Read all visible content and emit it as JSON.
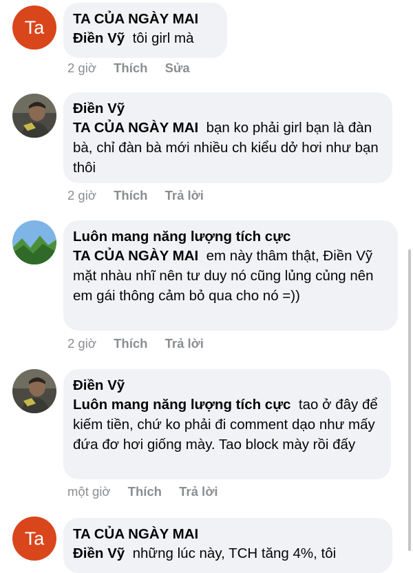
{
  "colors": {
    "bubble_bg": "#f0f2f5",
    "meta_text": "#8a8d91",
    "avatar_ta_bg": "#d9461c"
  },
  "comments": [
    {
      "avatar_text": "Ta",
      "author": "TA CỦA NGÀY MAI",
      "mention": "Điền Vỹ",
      "text": "tôi girl mà",
      "time": "2 giờ",
      "like": "Thích",
      "action": "Sửa"
    },
    {
      "author": "Điền Vỹ",
      "mention": "TA CỦA NGÀY MAI",
      "text": "bạn ko phải girl bạn là đàn bà, chỉ đàn bà mới nhiều ch  kiểu dở hơi như bạn thôi",
      "time": "2 giờ",
      "like": "Thích",
      "action": "Trả lời"
    },
    {
      "author": "Luôn mang năng lượng tích cực",
      "mention": "TA CỦA NGÀY MAI",
      "text": "em này thâm thật, Điền Vỹ mặt nhàu nhĩ nên tư duy nó cũng lủng củng nên em gái thông cảm bỏ qua cho nó =))",
      "time": "2 giờ",
      "like": "Thích",
      "action": "Trả lời"
    },
    {
      "author": "Điền Vỹ",
      "mention": "Luôn mang năng lượng tích cực",
      "text": "tao ở đây để kiếm tiền, chứ ko phải đi comment dạo như mấy đứa đơ hơi giống mày. Tao block mày rồi đấy",
      "time": "một giờ",
      "like": "Thích",
      "action": "Trả lời"
    },
    {
      "avatar_text": "Ta",
      "author": "TA CỦA NGÀY MAI",
      "mention": "Điền Vỹ",
      "text": "những lúc này, TCH tăng 4%, tôi"
    }
  ]
}
